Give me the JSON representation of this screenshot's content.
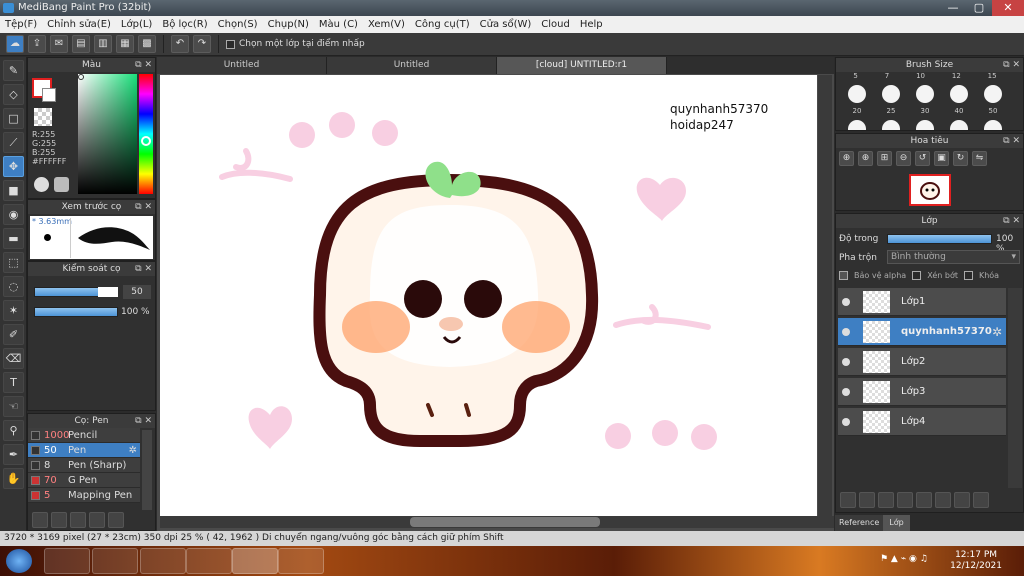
{
  "window": {
    "title": "MediBang Paint Pro (32bit)",
    "min": "—",
    "max": "▢",
    "close": "✕"
  },
  "menu": [
    "Tệp(F)",
    "Chỉnh sửa(E)",
    "Lớp(L)",
    "Bộ lọc(R)",
    "Chọn(S)",
    "Chụp(N)",
    "Màu (C)",
    "Xem(V)",
    "Công cụ(T)",
    "Cửa sổ(W)",
    "Cloud",
    "Help"
  ],
  "toolbar": {
    "select_layer_label": "Chọn một lớp tại điểm nhấp"
  },
  "tabs": [
    "Untitled",
    "Untitled",
    "[cloud] UNTITLED:r1"
  ],
  "color_panel": {
    "title": "Màu",
    "r": "R:255",
    "g": "G:255",
    "b": "B:255",
    "hex": "#FFFFFF"
  },
  "preview_panel": {
    "title": "Xem trước cọ",
    "size": "3.63mm"
  },
  "brush_control": {
    "title": "Kiểm soát cọ",
    "size_value": "50",
    "opacity_value": "100 %"
  },
  "brush_panel": {
    "title": "Cọ: Pen",
    "items": [
      {
        "size": "1000",
        "name": "Pencil"
      },
      {
        "size": "50",
        "name": "Pen"
      },
      {
        "size": "8",
        "name": "Pen (Sharp)"
      },
      {
        "size": "70",
        "name": "G Pen"
      },
      {
        "size": "5",
        "name": "Mapping Pen"
      }
    ]
  },
  "brush_size_panel": {
    "title": "Brush Size",
    "row1": [
      "5",
      "7",
      "10",
      "12",
      "15"
    ],
    "row2": [
      "20",
      "25",
      "30",
      "40",
      "50"
    ]
  },
  "navigator": {
    "title": "Hoa tiêu"
  },
  "layer_panel": {
    "title": "Lớp",
    "opacity_label": "Độ trong",
    "opacity_value": "100 %",
    "blend_label": "Pha trộn",
    "blend_value": "Bình thường",
    "protect_alpha": "Bảo vệ alpha",
    "clip": "Xén bớt",
    "lock": "Khóa",
    "layers": [
      "Lớp1",
      "quynhanh57370",
      "Lớp2",
      "Lớp3",
      "Lớp4"
    ]
  },
  "bottom_tabs": [
    "Reference",
    "Lớp"
  ],
  "canvas_text": {
    "line1": "quynhanh57370",
    "line2": "hoidap247"
  },
  "status": {
    "text": "3720 * 3169 pixel   (27 * 23cm)   350 dpi   25 %   ( 42, 1962 )   Di chuyển ngang/vuông góc bằng cách giữ phím Shift"
  },
  "clock": {
    "time": "12:17 PM",
    "date": "12/12/2021"
  }
}
